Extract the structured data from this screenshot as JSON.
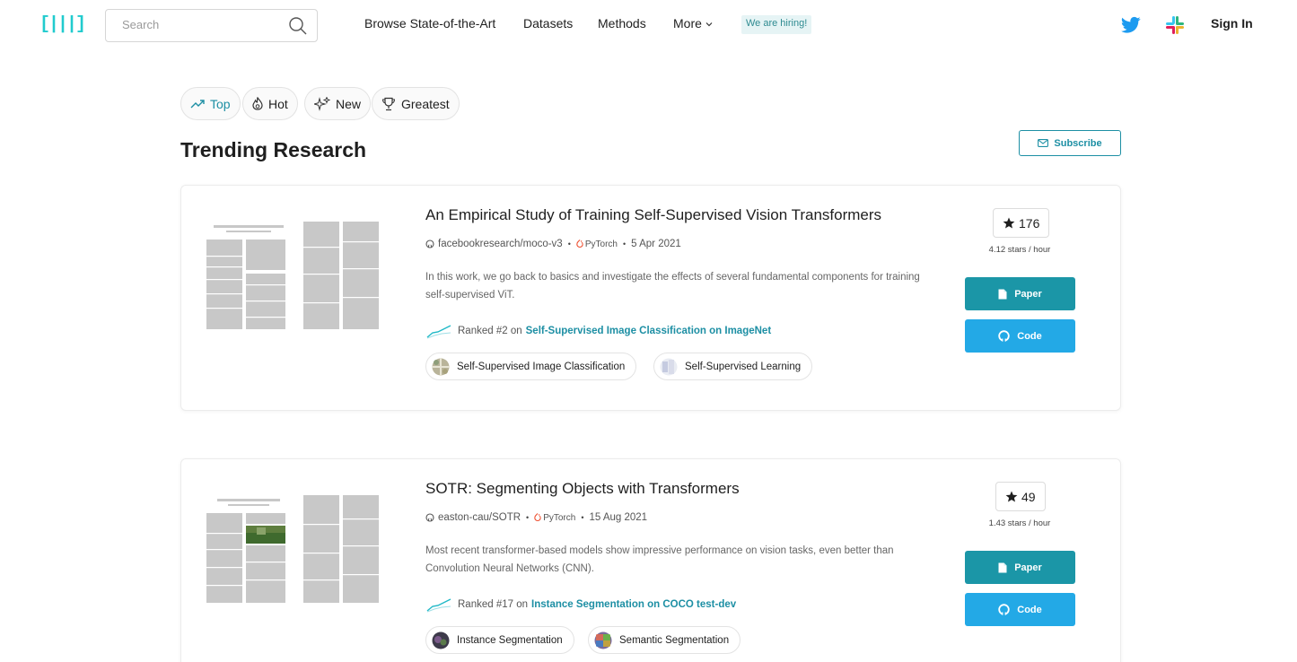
{
  "navbar": {
    "logo": "[|||]",
    "search_placeholder": "Search",
    "links": [
      "Browse State-of-the-Art",
      "Datasets",
      "Methods",
      "More"
    ],
    "hiring": "We are hiring!",
    "sign_in": "Sign In"
  },
  "tabs": [
    {
      "label": "Top",
      "icon": "trending-icon",
      "active": true
    },
    {
      "label": "Hot",
      "icon": "flame-icon",
      "active": false
    },
    {
      "label": "New",
      "icon": "sparkles-icon",
      "active": false
    },
    {
      "label": "Greatest",
      "icon": "trophy-icon",
      "active": false
    }
  ],
  "section": {
    "title": "Trending Research",
    "subscribe": "Subscribe"
  },
  "papers": [
    {
      "title": "An Empirical Study of Training Self-Supervised Vision Transformers",
      "repo": "facebookresearch/moco-v3",
      "framework": "PyTorch",
      "date": "5 Apr 2021",
      "abstract": "In this work, we go back to basics and investigate the effects of several fundamental components for training self-supervised ViT.",
      "rank_prefix": "Ranked #2 on",
      "rank_link": "Self-Supervised Image Classification on ImageNet",
      "tasks": [
        "Self-Supervised Image Classification",
        "Self-Supervised Learning"
      ],
      "stars": "176",
      "rate": "4.12 stars / hour",
      "paper_btn": "Paper",
      "code_btn": "Code"
    },
    {
      "title": "SOTR: Segmenting Objects with Transformers",
      "repo": "easton-cau/SOTR",
      "framework": "PyTorch",
      "date": "15 Aug 2021",
      "abstract": "Most recent transformer-based models show impressive performance on vision tasks, even better than Convolution Neural Networks (CNN).",
      "rank_prefix": "Ranked #17 on",
      "rank_link": "Instance Segmentation on COCO test-dev",
      "tasks": [
        "Instance Segmentation",
        "Semantic Segmentation"
      ],
      "stars": "49",
      "rate": "1.43 stars / hour",
      "paper_btn": "Paper",
      "code_btn": "Code"
    }
  ],
  "colors": {
    "accent": "#1d8fa4",
    "logo": "#21cbce",
    "paper_button": "#1b96a7",
    "code_button": "#23a9e6",
    "hiring_bg": "#e6f4f5"
  }
}
